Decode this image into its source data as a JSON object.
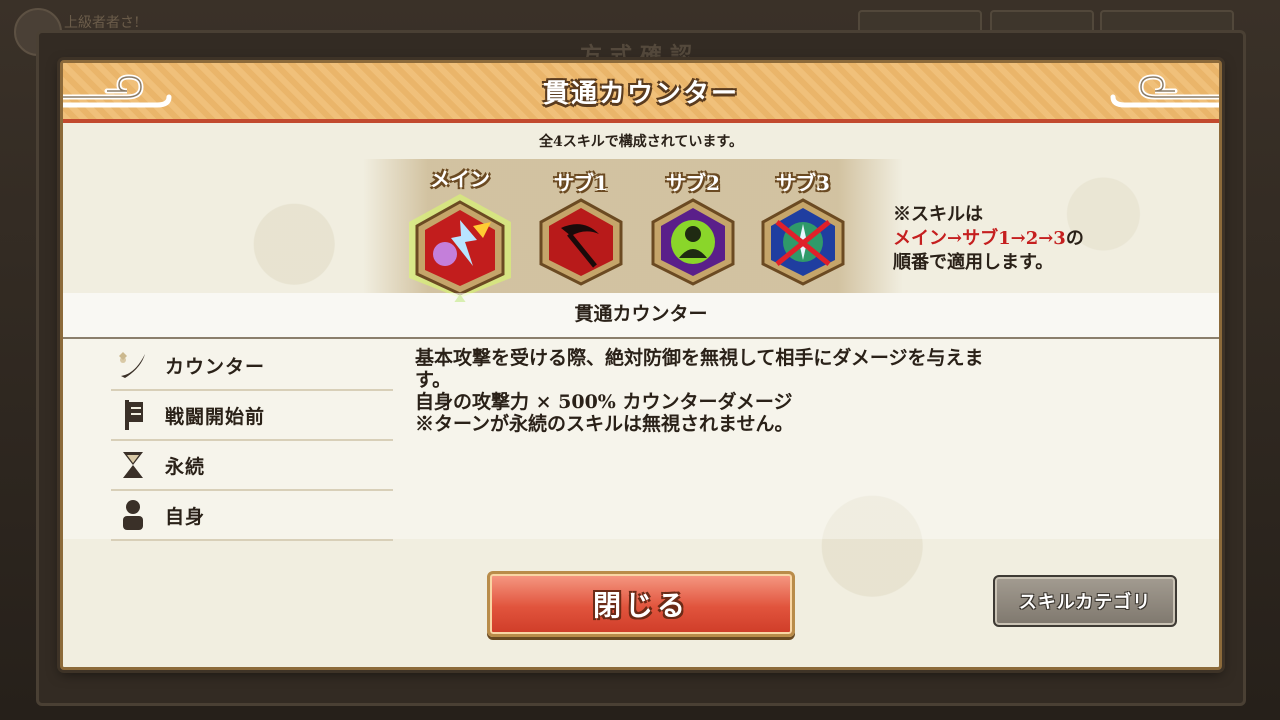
{
  "background": {
    "header_text": "上級者者さ!",
    "title": "方式確認"
  },
  "dialog": {
    "title": "貫通カウンター",
    "subtitle": "全4スキルで構成されています。",
    "skills": [
      {
        "label": "メイン",
        "icon": "main-skill-icon",
        "selected": true
      },
      {
        "label": "サブ1",
        "icon": "scythe-skill-icon",
        "selected": false
      },
      {
        "label": "サブ2",
        "icon": "person-skill-icon",
        "selected": false
      },
      {
        "label": "サブ3",
        "icon": "compass-skill-icon",
        "selected": false
      }
    ],
    "note": {
      "line1": "※スキルは",
      "line2": "メイン→サブ1→2→3",
      "line2_suffix": "の",
      "line3": "順番で適用します。"
    },
    "selected_skill_name": "貫通カウンター",
    "attributes": [
      {
        "label": "カウンター",
        "icon": "sword-icon"
      },
      {
        "label": "戦闘開始前",
        "icon": "banner-icon"
      },
      {
        "label": "永続",
        "icon": "hourglass-icon"
      },
      {
        "label": "自身",
        "icon": "person-icon"
      }
    ],
    "description": [
      "基本攻撃を受ける際、絶対防御を無視して相手にダメージを与えま",
      "す。",
      "自身の攻撃力 × 500% カウンターダメージ",
      "※ターンが永続のスキルは無視されません。"
    ],
    "close_button": "閉じる",
    "category_button": "スキルカテゴリ"
  },
  "colors": {
    "accent_red": "#c51f1f",
    "header_gold": "#f0c07a",
    "close_button_red": "#e1543d"
  }
}
